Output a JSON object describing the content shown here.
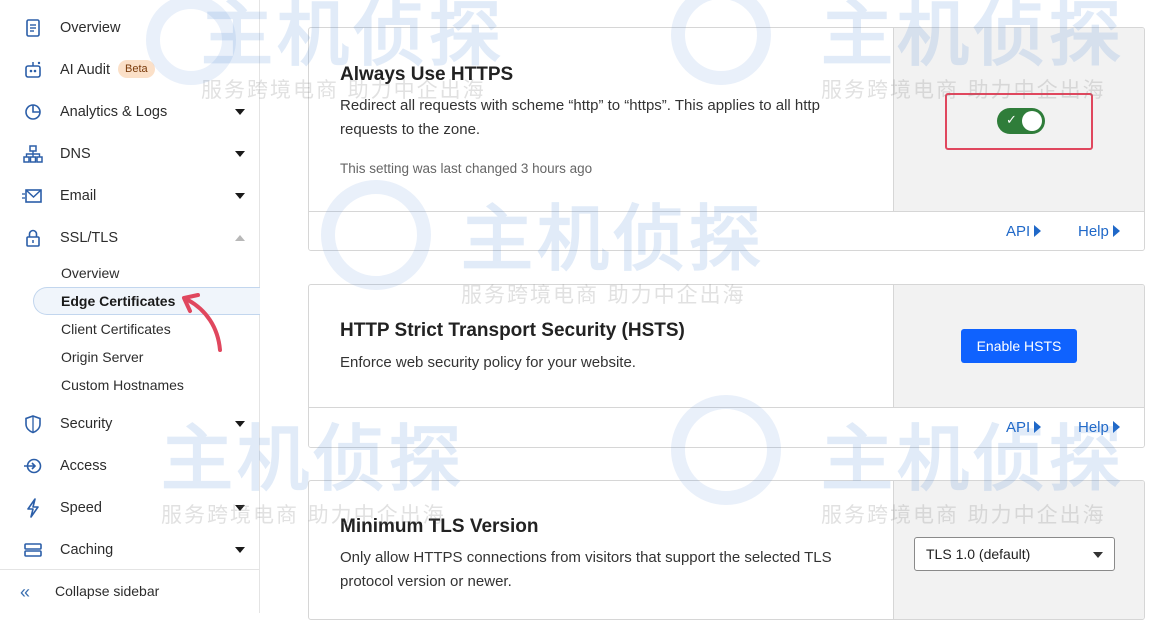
{
  "sidebar": {
    "items": [
      {
        "label": "Overview",
        "icon": "document-icon",
        "caret": "none"
      },
      {
        "label": "AI Audit",
        "icon": "ai-audit-icon",
        "badge": "Beta",
        "caret": "none"
      },
      {
        "label": "Analytics & Logs",
        "icon": "analytics-pie-icon",
        "caret": "down"
      },
      {
        "label": "DNS",
        "icon": "network-icon",
        "caret": "down"
      },
      {
        "label": "Email",
        "icon": "envelope-icon",
        "caret": "down"
      },
      {
        "label": "SSL/TLS",
        "icon": "lock-icon",
        "caret": "up"
      },
      {
        "label": "Security",
        "icon": "shield-icon",
        "caret": "down"
      },
      {
        "label": "Access",
        "icon": "access-icon",
        "caret": "none"
      },
      {
        "label": "Speed",
        "icon": "lightning-icon",
        "caret": "down"
      },
      {
        "label": "Caching",
        "icon": "storage-icon",
        "caret": "down"
      }
    ],
    "ssl_sub_items": [
      "Overview",
      "Edge Certificates",
      "Client Certificates",
      "Origin Server",
      "Custom Hostnames"
    ],
    "active_sub_item": "Edge Certificates",
    "collapse_label": "Collapse sidebar"
  },
  "cards": {
    "https": {
      "title": "Always Use HTTPS",
      "description": "Redirect all requests with scheme “http” to “https”. This applies to all http requests to the zone.",
      "note": "This setting was last changed 3 hours ago",
      "toggle_on": true,
      "api_label": "API",
      "help_label": "Help"
    },
    "hsts": {
      "title": "HTTP Strict Transport Security (HSTS)",
      "description": "Enforce web security policy for your website.",
      "button_label": "Enable HSTS",
      "api_label": "API",
      "help_label": "Help"
    },
    "tls": {
      "title": "Minimum TLS Version",
      "description": "Only allow HTTPS connections from visitors that support the selected TLS protocol version or newer.",
      "select_value": "TLS 1.0 (default)"
    }
  },
  "watermark": {
    "logo_text": "主机侦探",
    "tagline": "服务跨境电商 助力中企出海"
  },
  "colors": {
    "accent_blue": "#0f62fe",
    "link_blue": "#1f68c8",
    "toggle_green": "#2f7d3a",
    "highlight_red": "#e0475e",
    "beta_badge": "#fbe0c8"
  }
}
